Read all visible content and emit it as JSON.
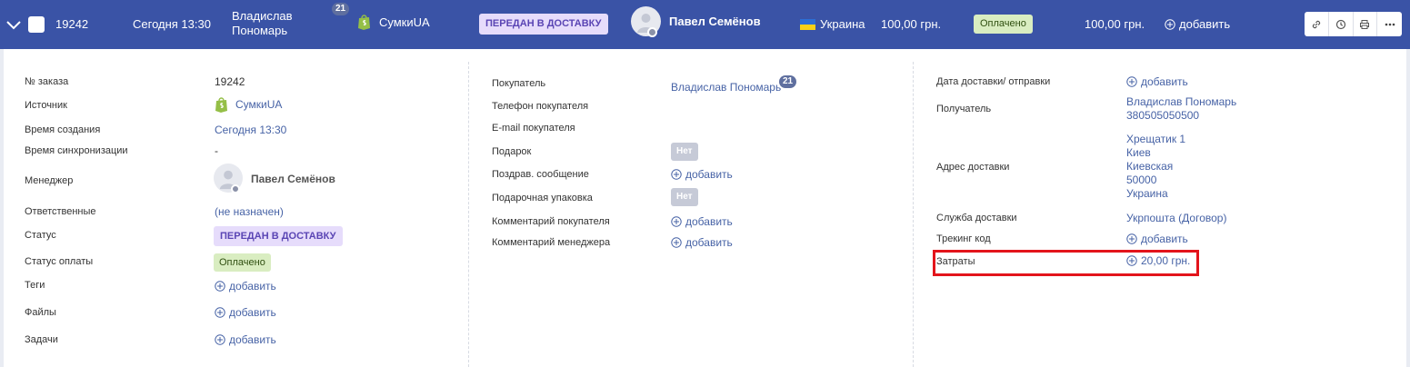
{
  "header": {
    "order_number": "19242",
    "created": "Сегодня 13:30",
    "customer_first": "Владислав",
    "customer_last": "Пономарь",
    "customer_orders_badge": "21",
    "shop": "СумкиUA",
    "status": "ПЕРЕДАН В ДОСТАВКУ",
    "manager": "Павел Семёнов",
    "country": "Украина",
    "sum": "100,00 грн.",
    "payment_status": "Оплачено",
    "total": "100,00 грн.",
    "add_label": "добавить",
    "tools": [
      "link-icon",
      "history-icon",
      "print-icon",
      "more-icon"
    ]
  },
  "colors": {
    "header_bg": "#3a53a6",
    "status_bg": "#e6dcfb",
    "status_fg": "#5a45b4",
    "paid_bg": "#d9edc1",
    "link": "#4763a6",
    "highlight": "#e3141b"
  },
  "col1": {
    "order_number_label": "№ заказа",
    "order_number": "19242",
    "source_label": "Источник",
    "source": "СумкиUA",
    "created_label": "Время создания",
    "created": "Сегодня 13:30",
    "sync_label": "Время синхронизации",
    "sync": "-",
    "manager_label": "Менеджер",
    "manager": "Павел Семёнов",
    "responsible_label": "Ответственные",
    "responsible": "(не назначен)",
    "status_label": "Статус",
    "status": "ПЕРЕДАН В ДОСТАВКУ",
    "payment_label": "Статус оплаты",
    "payment": "Оплачено",
    "tags_label": "Теги",
    "files_label": "Файлы",
    "tasks_label": "Задачи",
    "add": "добавить"
  },
  "col2": {
    "buyer_label": "Покупатель",
    "buyer": "Владислав Пономарь",
    "buyer_badge": "21",
    "phone_label": "Телефон покупателя",
    "email_label": "E-mail покупателя",
    "gift_label": "Подарок",
    "gift": "Нет",
    "greeting_label": "Поздрав. сообщение",
    "wrap_label": "Подарочная упаковка",
    "wrap": "Нет",
    "buyer_comment_label": "Комментарий покупателя",
    "manager_comment_label": "Комментарий менеджера",
    "add": "добавить"
  },
  "col3": {
    "delivery_date_label": "Дата доставки/ отправки",
    "recipient_label": "Получатель",
    "recipient_name": "Владислав Пономарь",
    "recipient_phone": "380505050500",
    "address_label": "Адрес доставки",
    "address_lines": [
      "Хрещатик 1",
      "Киев",
      "Киевская",
      "50000",
      "Украина"
    ],
    "service_label": "Служба доставки",
    "service": "Укрпошта (Договор)",
    "tracking_label": "Трекинг код",
    "costs_label": "Затраты",
    "costs": "20,00 грн.",
    "add": "добавить"
  }
}
